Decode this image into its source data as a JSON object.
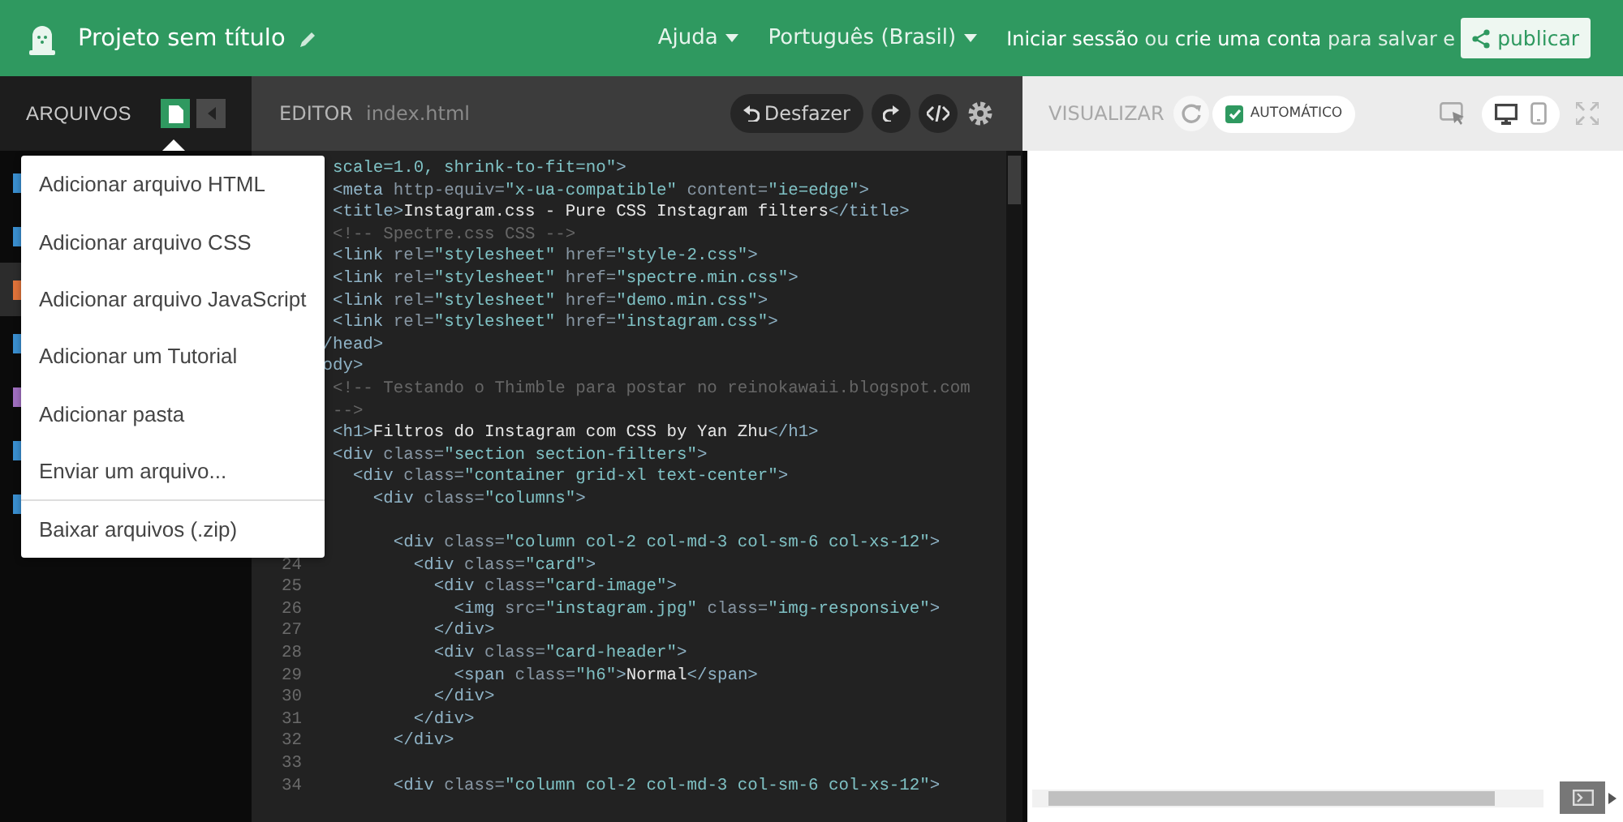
{
  "header": {
    "title": "Projeto sem título",
    "help": "Ajuda",
    "language": "Português (Brasil)",
    "signin": "**Iniciar sessão** ou **crie uma conta** para salvar e",
    "publish": "publicar"
  },
  "toolbar": {
    "files_label": "ARQUIVOS",
    "editor_label": "EDITOR",
    "filename": "index.html",
    "undo": "Desfazer",
    "preview_label": "VISUALIZAR",
    "auto": {
      "label": "AUTOMÁTICO",
      "checked": true
    },
    "devices": [
      {
        "kind": "desktop",
        "selected": true
      },
      {
        "kind": "mobile",
        "selected": false
      }
    ]
  },
  "files": [
    {
      "color": "#3a8fd0",
      "selected": false
    },
    {
      "color": "#3a8fd0",
      "selected": false
    },
    {
      "color": "#e0733a",
      "selected": true
    },
    {
      "color": "#3a8fd0",
      "selected": false
    },
    {
      "color": "#a06fc0",
      "selected": false
    },
    {
      "color": "#3a8fd0",
      "selected": false
    },
    {
      "color": "#3a8fd0",
      "selected": false
    }
  ],
  "add_menu": {
    "items": [
      {
        "label": "Adicionar arquivo HTML",
        "separated": false
      },
      {
        "label": "Adicionar arquivo CSS",
        "separated": false
      },
      {
        "label": "Adicionar arquivo JavaScript",
        "separated": false
      },
      {
        "label": "Adicionar um Tutorial",
        "separated": false
      },
      {
        "label": "Adicionar pasta",
        "separated": false
      },
      {
        "label": "Enviar um arquivo...",
        "separated": false
      },
      {
        "label": "Baixar arquivos (.zip)",
        "separated": true
      }
    ]
  },
  "code": [
    {
      "kind": "code",
      "tokens": [
        {
          "kind": "string",
          "text": "  scale=1.0, shrink-to-fit=no\""
        },
        {
          "kind": "tag",
          "text": ">"
        }
      ]
    },
    {
      "kind": "code",
      "tokens": [
        {
          "kind": "tag",
          "text": "  <meta"
        },
        {
          "kind": "attr",
          "text": " http-equiv="
        },
        {
          "kind": "string",
          "text": "\"x-ua-compatible\""
        },
        {
          "kind": "attr",
          "text": " content="
        },
        {
          "kind": "string",
          "text": "\"ie=edge\""
        },
        {
          "kind": "tag",
          "text": ">"
        }
      ]
    },
    {
      "kind": "code",
      "tokens": [
        {
          "kind": "tag",
          "text": "  <title>"
        },
        {
          "kind": "text",
          "text": "Instagram.css - Pure CSS Instagram filters"
        },
        {
          "kind": "tag",
          "text": "</title>"
        }
      ]
    },
    {
      "kind": "code",
      "tokens": [
        {
          "kind": "comment",
          "text": "  <!-- Spectre.css CSS -->"
        }
      ]
    },
    {
      "kind": "code",
      "tokens": [
        {
          "kind": "tag",
          "text": "  <link"
        },
        {
          "kind": "attr",
          "text": " rel="
        },
        {
          "kind": "string",
          "text": "\"stylesheet\""
        },
        {
          "kind": "attr",
          "text": " href="
        },
        {
          "kind": "string",
          "text": "\"style-2.css\""
        },
        {
          "kind": "tag",
          "text": ">"
        }
      ]
    },
    {
      "kind": "code",
      "tokens": [
        {
          "kind": "tag",
          "text": "  <link"
        },
        {
          "kind": "attr",
          "text": " rel="
        },
        {
          "kind": "string",
          "text": "\"stylesheet\""
        },
        {
          "kind": "attr",
          "text": " href="
        },
        {
          "kind": "string",
          "text": "\"spectre.min.css\""
        },
        {
          "kind": "tag",
          "text": ">"
        }
      ]
    },
    {
      "kind": "code",
      "tokens": [
        {
          "kind": "tag",
          "text": "  <link"
        },
        {
          "kind": "attr",
          "text": " rel="
        },
        {
          "kind": "string",
          "text": "\"stylesheet\""
        },
        {
          "kind": "attr",
          "text": " href="
        },
        {
          "kind": "string",
          "text": "\"demo.min.css\""
        },
        {
          "kind": "tag",
          "text": ">"
        }
      ]
    },
    {
      "kind": "code",
      "tokens": [
        {
          "kind": "tag",
          "text": "  <link"
        },
        {
          "kind": "attr",
          "text": " rel="
        },
        {
          "kind": "string",
          "text": "\"stylesheet\""
        },
        {
          "kind": "attr",
          "text": " href="
        },
        {
          "kind": "string",
          "text": "\"instagram.css\""
        },
        {
          "kind": "tag",
          "text": ">"
        }
      ]
    },
    {
      "kind": "code",
      "tokens": [
        {
          "kind": "tag",
          "text": " /head>"
        }
      ]
    },
    {
      "kind": "code",
      "tokens": [
        {
          "kind": "tag",
          "text": " ody>"
        }
      ]
    },
    {
      "kind": "code",
      "tokens": [
        {
          "kind": "comment",
          "text": "  <!-- Testando o Thimble para postar no reinokawaii.blogspot.com"
        }
      ]
    },
    {
      "kind": "code",
      "tokens": [
        {
          "kind": "comment",
          "text": "  -->"
        }
      ]
    },
    {
      "kind": "code",
      "tokens": [
        {
          "kind": "tag",
          "text": "  <h1>"
        },
        {
          "kind": "text",
          "text": "Filtros do Instagram com CSS by Yan Zhu"
        },
        {
          "kind": "tag",
          "text": "</h1>"
        }
      ]
    },
    {
      "kind": "code",
      "tokens": [
        {
          "kind": "tag",
          "text": "  <div"
        },
        {
          "kind": "attr",
          "text": " class="
        },
        {
          "kind": "string",
          "text": "\"section section-filters\""
        },
        {
          "kind": "tag",
          "text": ">"
        }
      ]
    },
    {
      "kind": "code",
      "tokens": [
        {
          "kind": "tag",
          "text": "    <div"
        },
        {
          "kind": "attr",
          "text": " class="
        },
        {
          "kind": "string",
          "text": "\"container grid-xl text-center\""
        },
        {
          "kind": "tag",
          "text": ">"
        }
      ]
    },
    {
      "kind": "code",
      "tokens": [
        {
          "kind": "tag",
          "text": "      <div"
        },
        {
          "kind": "attr",
          "text": " class="
        },
        {
          "kind": "string",
          "text": "\"columns\""
        },
        {
          "kind": "tag",
          "text": ">"
        }
      ]
    },
    {
      "kind": "blank"
    },
    {
      "kind": "code",
      "tokens": [
        {
          "kind": "tag",
          "text": "        <div"
        },
        {
          "kind": "attr",
          "text": " class="
        },
        {
          "kind": "string",
          "text": "\"column col-2 col-md-3 col-sm-6 col-xs-12\""
        },
        {
          "kind": "tag",
          "text": ">"
        }
      ]
    },
    {
      "kind": "code",
      "number": "24",
      "tokens": [
        {
          "kind": "tag",
          "text": "          <div"
        },
        {
          "kind": "attr",
          "text": " class="
        },
        {
          "kind": "string",
          "text": "\"card\""
        },
        {
          "kind": "tag",
          "text": ">"
        }
      ]
    },
    {
      "kind": "code",
      "number": "25",
      "tokens": [
        {
          "kind": "tag",
          "text": "            <div"
        },
        {
          "kind": "attr",
          "text": " class="
        },
        {
          "kind": "string",
          "text": "\"card-image\""
        },
        {
          "kind": "tag",
          "text": ">"
        }
      ]
    },
    {
      "kind": "code",
      "number": "26",
      "tokens": [
        {
          "kind": "tag",
          "text": "              <img"
        },
        {
          "kind": "attr",
          "text": " src="
        },
        {
          "kind": "string",
          "text": "\"instagram.jpg\""
        },
        {
          "kind": "attr",
          "text": " class="
        },
        {
          "kind": "string",
          "text": "\"img-responsive\""
        },
        {
          "kind": "tag",
          "text": ">"
        }
      ]
    },
    {
      "kind": "code",
      "number": "27",
      "tokens": [
        {
          "kind": "tag",
          "text": "            </div>"
        }
      ]
    },
    {
      "kind": "code",
      "number": "28",
      "tokens": [
        {
          "kind": "tag",
          "text": "            <div"
        },
        {
          "kind": "attr",
          "text": " class="
        },
        {
          "kind": "string",
          "text": "\"card-header\""
        },
        {
          "kind": "tag",
          "text": ">"
        }
      ]
    },
    {
      "kind": "code",
      "number": "29",
      "tokens": [
        {
          "kind": "tag",
          "text": "              <span"
        },
        {
          "kind": "attr",
          "text": " class="
        },
        {
          "kind": "string",
          "text": "\"h6\""
        },
        {
          "kind": "tag",
          "text": ">"
        },
        {
          "kind": "text",
          "text": "Normal"
        },
        {
          "kind": "tag",
          "text": "</span>"
        }
      ]
    },
    {
      "kind": "code",
      "number": "30",
      "tokens": [
        {
          "kind": "tag",
          "text": "            </div>"
        }
      ]
    },
    {
      "kind": "code",
      "number": "31",
      "tokens": [
        {
          "kind": "tag",
          "text": "          </div>"
        }
      ]
    },
    {
      "kind": "code",
      "number": "32",
      "tokens": [
        {
          "kind": "tag",
          "text": "        </div>"
        }
      ]
    },
    {
      "kind": "blank",
      "number": "33"
    },
    {
      "kind": "code",
      "number": "34",
      "tokens": [
        {
          "kind": "tag",
          "text": "        <div"
        },
        {
          "kind": "attr",
          "text": " class="
        },
        {
          "kind": "string",
          "text": "\"column col-2 col-md-3 col-sm-6 col-xs-12\""
        },
        {
          "kind": "tag",
          "text": ">"
        }
      ]
    }
  ]
}
